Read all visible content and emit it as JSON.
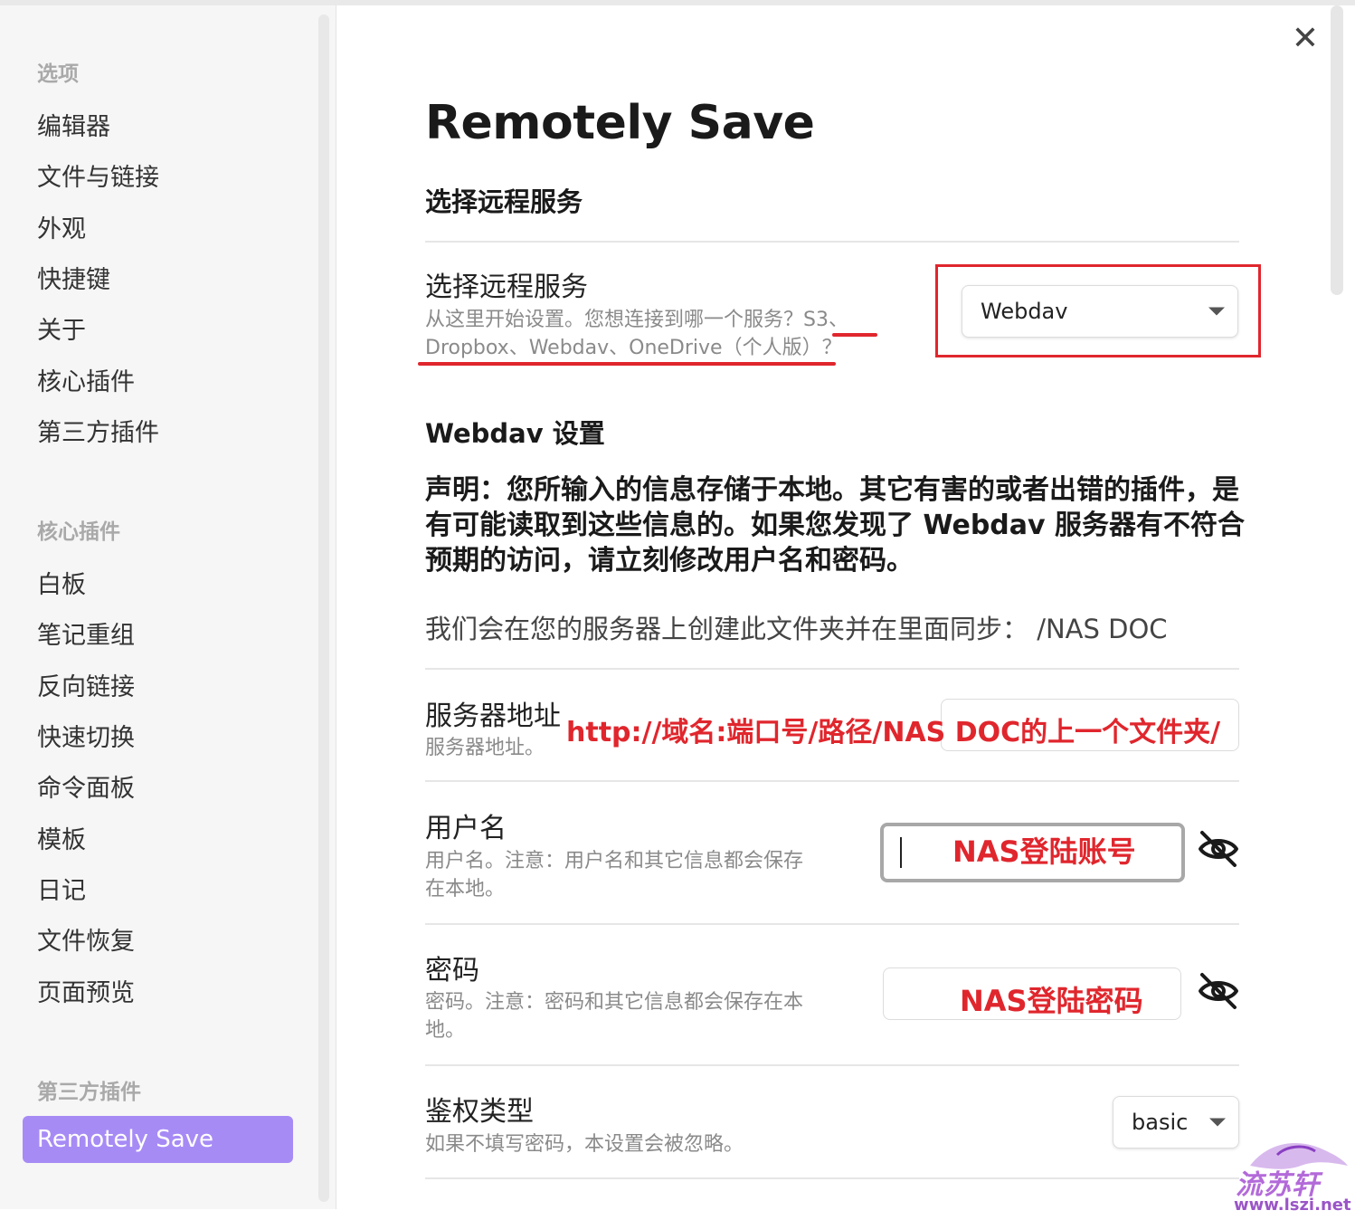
{
  "dialog": {
    "close_label": "✕"
  },
  "sidebar": {
    "options_title": "选项",
    "options": [
      "编辑器",
      "文件与链接",
      "外观",
      "快捷键",
      "关于",
      "核心插件",
      "第三方插件"
    ],
    "core_title": "核心插件",
    "core": [
      "白板",
      "笔记重组",
      "反向链接",
      "快速切换",
      "命令面板",
      "模板",
      "日记",
      "文件恢复",
      "页面预览"
    ],
    "third_title": "第三方插件",
    "third": [
      "Remotely Save"
    ]
  },
  "main": {
    "title": "Remotely Save",
    "section_service": "选择远程服务",
    "service": {
      "name": "选择远程服务",
      "desc_line1": "从这里开始设置。您想连接到哪一个服务？S3、",
      "desc_line2": "Dropbox、Webdav、OneDrive（个人版）？",
      "selected": "Webdav"
    },
    "section_webdav": "Webdav 设置",
    "notice": {
      "part1": "声明：您所输入的信息存储于本地。其它有害的或者出错的插件，是有可能读取到这些信息的。如果您发现了 ",
      "bold": "Webdav",
      "part2": " 服务器有不符合预期的访问，请立刻修改用户名和密码。"
    },
    "folder_line": "我们会在您的服务器上创建此文件夹并在里面同步： /NAS DOC",
    "server": {
      "name": "服务器地址",
      "desc": "服务器地址。",
      "annotation": "http://域名:端口号/路径/NAS DOC的上一个文件夹/"
    },
    "username": {
      "name": "用户名",
      "desc_line1": "用户名。注意：用户名和其它信息都会保存",
      "desc_line2": "在本地。",
      "annotation": "NAS登陆账号"
    },
    "password": {
      "name": "密码",
      "desc_line1": "密码。注意：密码和其它信息都会保存在本",
      "desc_line2": "地。",
      "annotation": "NAS登陆密码"
    },
    "auth": {
      "name": "鉴权类型",
      "desc": "如果不填写密码，本设置会被忽略。",
      "selected": "basic"
    }
  },
  "watermark": {
    "line1": "流苏轩",
    "line2": "www.lszi.net"
  },
  "colors": {
    "accent": "#a78bf5",
    "annotation_red": "#e0262d"
  }
}
